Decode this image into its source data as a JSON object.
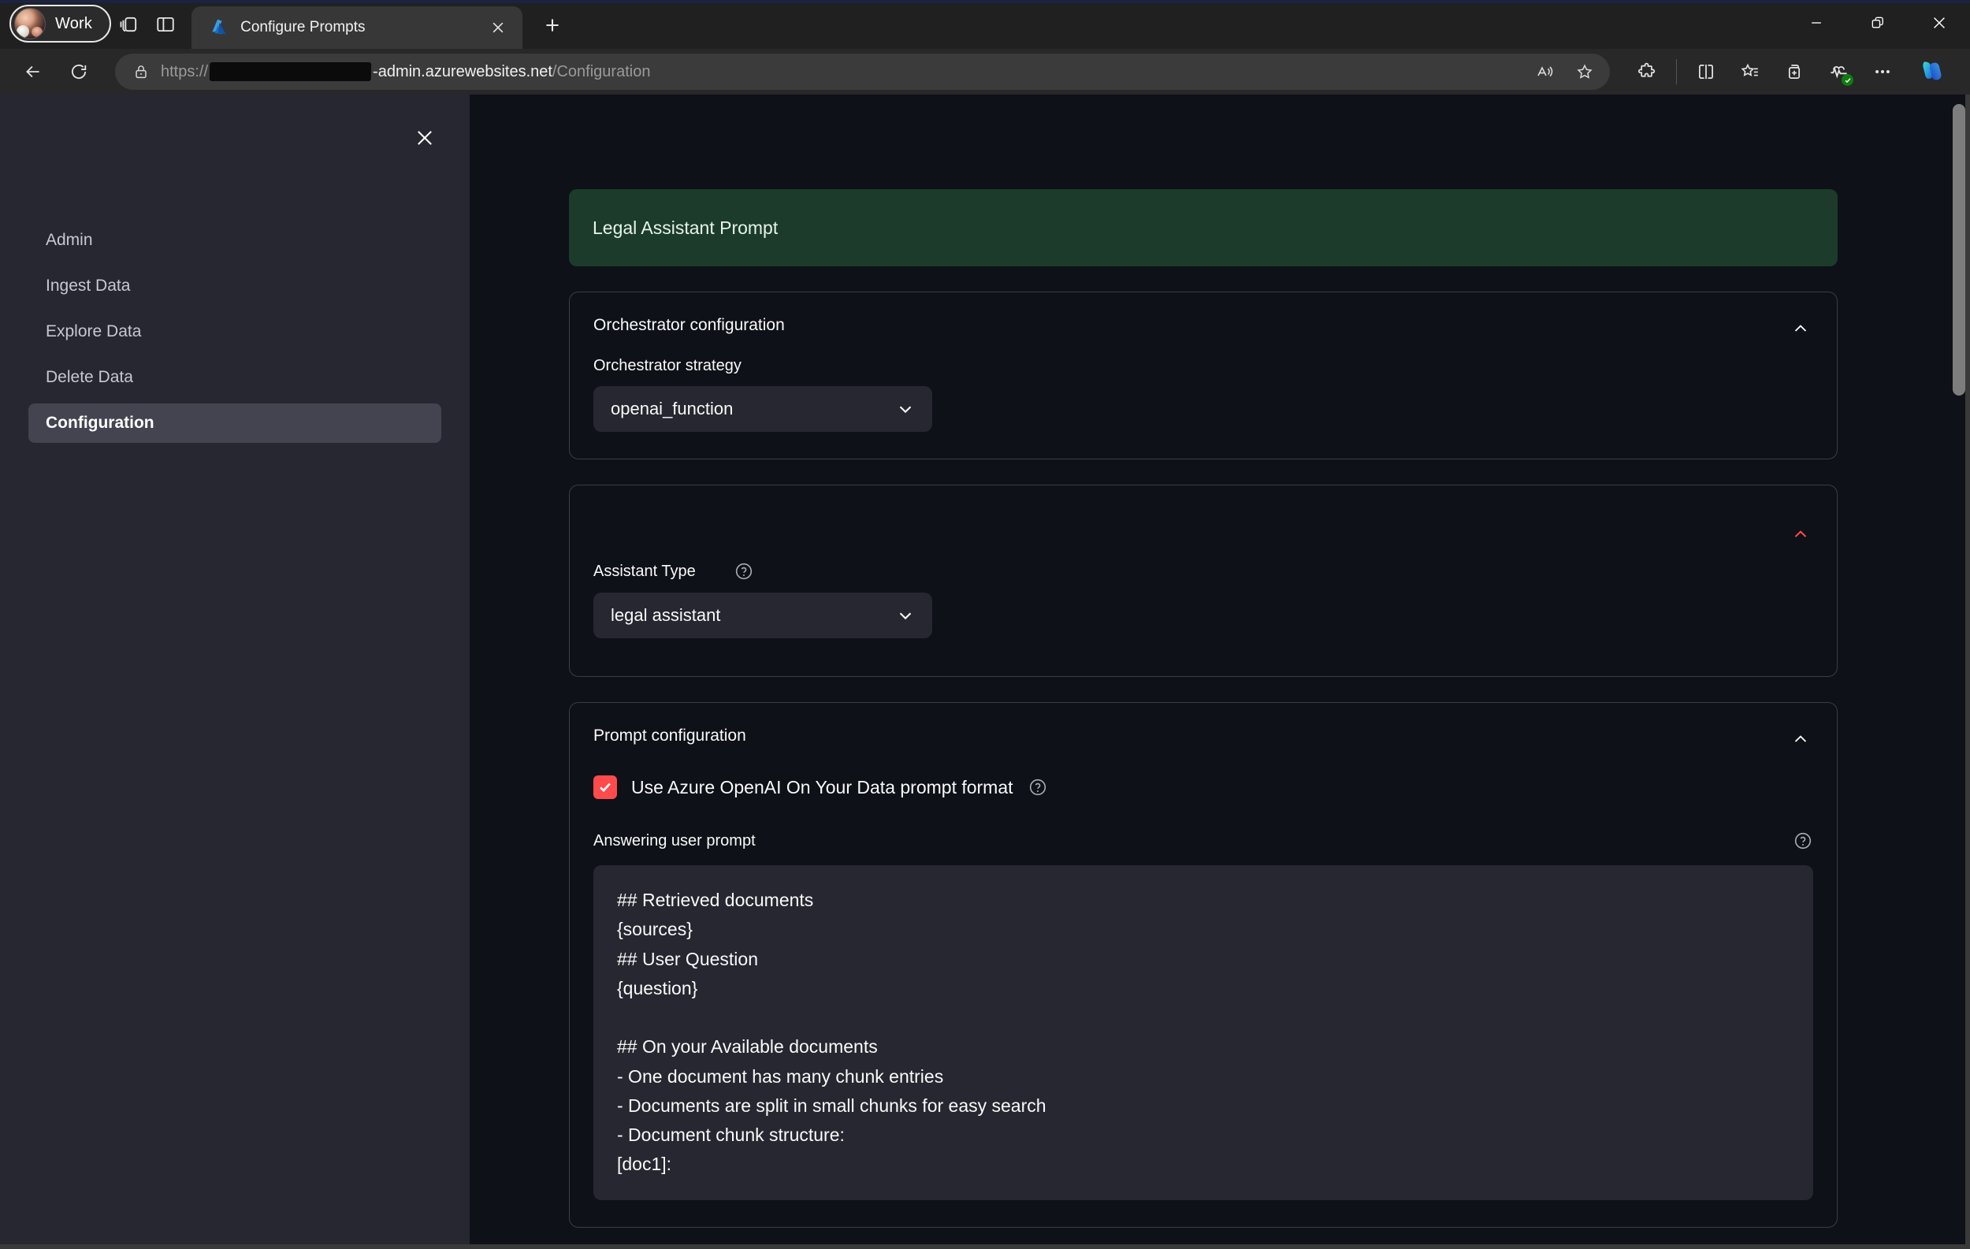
{
  "browser": {
    "profile": {
      "label": "Work",
      "avatar_icon": "user-avatar-photo"
    },
    "icons": {
      "tab_groups": "tab-groups-icon",
      "split_pane": "sidebar-toggle-icon",
      "new_tab": "new-tab-plus-icon",
      "back": "back-arrow-icon",
      "refresh": "refresh-icon",
      "lock": "lock-icon",
      "read_aloud": "read-aloud-icon",
      "favorite": "favorite-star-icon",
      "extensions": "extensions-puzzle-icon",
      "split_screen": "split-screen-icon",
      "collections": "collections-star-icon",
      "browser_essentials": "add-to-collection-icon",
      "performance": "browser-health-icon",
      "settings_more": "ellipsis-more-icon",
      "copilot": "copilot-icon",
      "minimize": "minimize-icon",
      "restore": "restore-window-icon",
      "close_window": "close-window-icon"
    },
    "tab": {
      "title": "Configure Prompts",
      "favicon": "azure-logo-icon",
      "close": "close-tab-icon"
    },
    "url": {
      "scheme": "https://",
      "redacted": "",
      "host_suffix": "-admin.azurewebsites.net",
      "path": "/Configuration"
    }
  },
  "sidebar": {
    "close_icon": "close-icon",
    "items": [
      {
        "label": "Admin",
        "active": false
      },
      {
        "label": "Ingest Data",
        "active": false
      },
      {
        "label": "Explore Data",
        "active": false
      },
      {
        "label": "Delete Data",
        "active": false
      },
      {
        "label": "Configuration",
        "active": true
      }
    ]
  },
  "main": {
    "banner": {
      "text": "Legal Assistant Prompt",
      "color": "#1c3b2a"
    },
    "orchestrator": {
      "section_title": "Orchestrator configuration",
      "collapse_icon": "chevron-up-icon",
      "strategy_label": "Orchestrator strategy",
      "strategy_value": "openai_function",
      "dropdown_icon": "chevron-down-icon"
    },
    "assistant": {
      "collapse_icon": "chevron-up-icon",
      "type_label": "Assistant Type",
      "help_icon": "help-circle-icon",
      "type_value": "legal assistant",
      "dropdown_icon": "chevron-down-icon"
    },
    "prompt": {
      "section_title": "Prompt configuration",
      "collapse_icon": "chevron-up-icon",
      "checkbox_checked": true,
      "checkbox_color": "#ff4b4b",
      "checkbox_label": "Use Azure OpenAI On Your Data prompt format",
      "checkbox_help_icon": "help-circle-icon",
      "answering_label": "Answering user prompt",
      "answering_help_icon": "help-circle-icon",
      "answering_value": "## Retrieved documents\n{sources}\n## User Question\n{question}\n\n## On your Available documents\n- One document has many chunk entries\n- Documents are split in small chunks for easy search\n- Document chunk structure:\n[doc1]:"
    }
  }
}
